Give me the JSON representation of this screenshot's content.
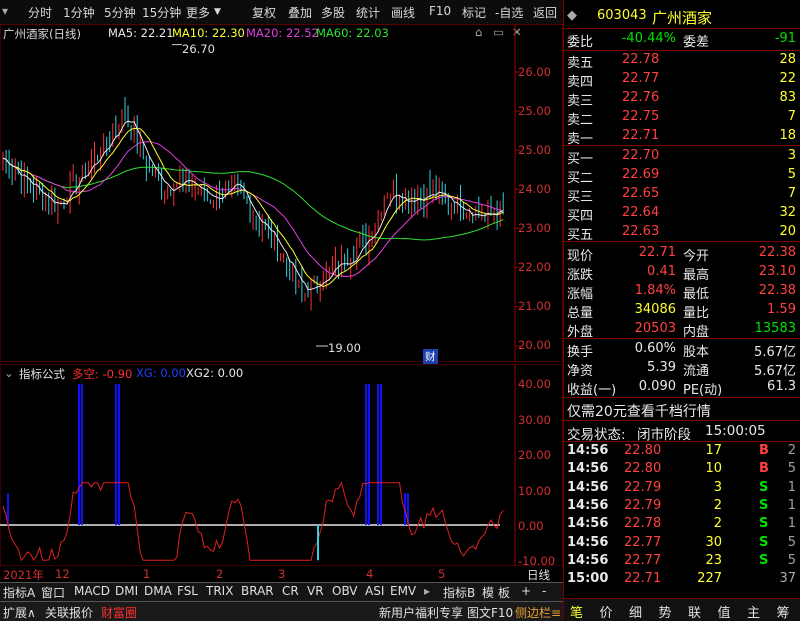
{
  "toolbar": {
    "items": [
      "分时",
      "1分钟",
      "5分钟",
      "15分钟",
      "更多",
      "复权",
      "叠加",
      "多股",
      "统计",
      "画线",
      "F10",
      "标记",
      "-自选",
      "返回"
    ]
  },
  "main_chart": {
    "title": "广州酒家(日线)",
    "ma5": "MA5: 22.21",
    "ma10": "MA10: 22.30",
    "ma20": "MA20: 22.52",
    "ma60": "MA60: 22.03",
    "high_marker": "26.70",
    "low_marker": "19.00",
    "cai_badge": "财",
    "y_ticks": [
      "26.00",
      "25.00",
      "24.00",
      "23.00",
      "22.00",
      "21.00",
      "20.00",
      "19.00"
    ]
  },
  "indicator": {
    "name": "指标公式",
    "duokong": "多空: -0.90",
    "xg": "XG: 0.00",
    "xg2": "XG2: 0.00",
    "y_ticks": [
      "40.00",
      "30.00",
      "20.00",
      "10.00",
      "0.00",
      "-10.00"
    ]
  },
  "date_axis": {
    "labels": [
      "2021年",
      "12",
      "1",
      "2",
      "3",
      "4",
      "5"
    ],
    "period": "日线"
  },
  "tabs": [
    "指标A",
    "窗口",
    "MACD",
    "DMI",
    "DMA",
    "FSL",
    "TRIX",
    "BRAR",
    "CR",
    "VR",
    "OBV",
    "ASI",
    "EMV",
    "指标B",
    "模",
    "板",
    "+",
    "-"
  ],
  "statusbar": {
    "left": [
      "扩展",
      "关联报价",
      "财富圈"
    ],
    "right": [
      "新用户福利专享",
      "图文F10",
      "侧边栏"
    ]
  },
  "panel": {
    "code": "603043",
    "name": "广州酒家",
    "weibi_label": "委比",
    "weibi": "-40.44%",
    "weicha_label": "委差",
    "weicha": "-91",
    "asks": [
      {
        "label": "卖五",
        "price": "22.78",
        "vol": "28"
      },
      {
        "label": "卖四",
        "price": "22.77",
        "vol": "22"
      },
      {
        "label": "卖三",
        "price": "22.76",
        "vol": "83"
      },
      {
        "label": "卖二",
        "price": "22.75",
        "vol": "7"
      },
      {
        "label": "卖一",
        "price": "22.71",
        "vol": "18"
      }
    ],
    "bids": [
      {
        "label": "买一",
        "price": "22.70",
        "vol": "3"
      },
      {
        "label": "买二",
        "price": "22.69",
        "vol": "5"
      },
      {
        "label": "买三",
        "price": "22.65",
        "vol": "7"
      },
      {
        "label": "买四",
        "price": "22.64",
        "vol": "32"
      },
      {
        "label": "买五",
        "price": "22.63",
        "vol": "20"
      }
    ],
    "quote": [
      {
        "l1": "现价",
        "v1": "22.71",
        "l2": "今开",
        "v2": "22.38"
      },
      {
        "l1": "涨跌",
        "v1": "0.41",
        "l2": "最高",
        "v2": "23.10"
      },
      {
        "l1": "涨幅",
        "v1": "1.84%",
        "l2": "最低",
        "v2": "22.38"
      },
      {
        "l1": "总量",
        "v1": "34086",
        "l2": "量比",
        "v2": "1.59"
      },
      {
        "l1": "外盘",
        "v1": "20503",
        "l2": "内盘",
        "v2": "13583"
      }
    ],
    "stats": [
      {
        "l1": "换手",
        "v1": "0.60%",
        "l2": "股本",
        "v2": "5.67亿"
      },
      {
        "l1": "净资",
        "v1": "5.39",
        "l2": "流通",
        "v2": "5.67亿"
      },
      {
        "l1": "收益(一)",
        "v1": "0.090",
        "l2": "PE(动)",
        "v2": "61.3"
      }
    ],
    "promo": "仅需20元查看千档行情",
    "status_label": "交易状态:",
    "status_value": "闭市阶段",
    "status_time": "15:00:05",
    "ticks": [
      {
        "t": "14:56",
        "p": "22.80",
        "v": "17",
        "d": "B",
        "n": "2"
      },
      {
        "t": "14:56",
        "p": "22.80",
        "v": "10",
        "d": "B",
        "n": "5"
      },
      {
        "t": "14:56",
        "p": "22.79",
        "v": "3",
        "d": "S",
        "n": "1"
      },
      {
        "t": "14:56",
        "p": "22.79",
        "v": "2",
        "d": "S",
        "n": "1"
      },
      {
        "t": "14:56",
        "p": "22.78",
        "v": "2",
        "d": "S",
        "n": "1"
      },
      {
        "t": "14:56",
        "p": "22.77",
        "v": "30",
        "d": "S",
        "n": "5"
      },
      {
        "t": "14:56",
        "p": "22.77",
        "v": "23",
        "d": "S",
        "n": "5"
      },
      {
        "t": "15:00",
        "p": "22.71",
        "v": "227",
        "d": "",
        "n": "37"
      }
    ],
    "bottom_tabs": [
      "笔",
      "价",
      "细",
      "势",
      "联",
      "值",
      "主",
      "筹"
    ]
  }
}
